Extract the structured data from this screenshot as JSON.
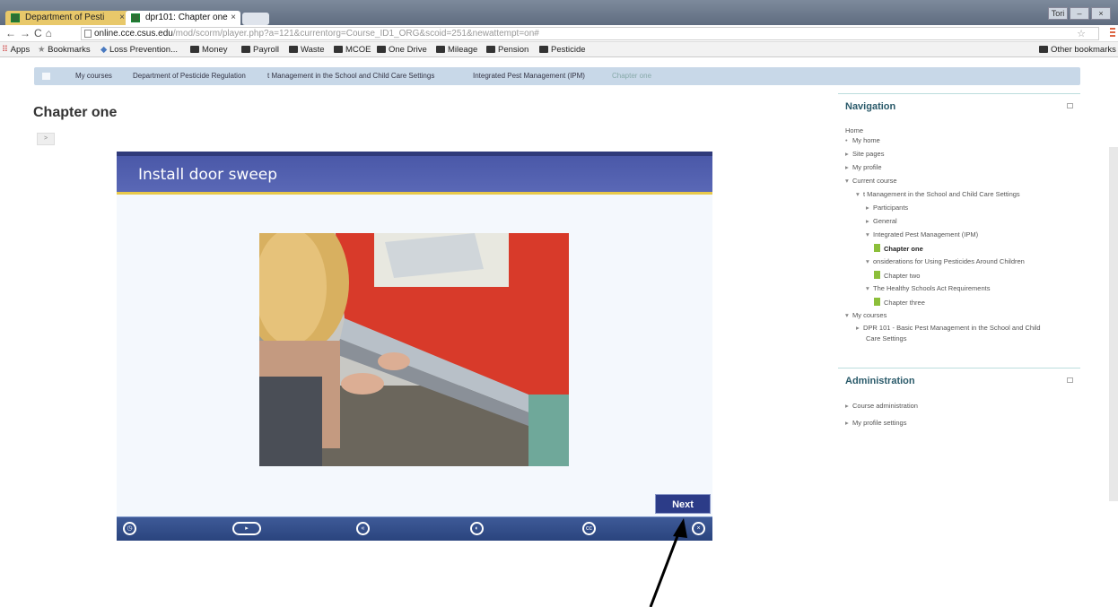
{
  "browser": {
    "tabs": [
      {
        "title": "Department of Pesti"
      },
      {
        "title": "dpr101: Chapter one"
      }
    ],
    "window_button": "Tori",
    "url": {
      "host": "online.cce.csus.edu",
      "path": "/mod/scorm/player.php?a=121&currentorg=Course_ID1_ORG&scoid=251&newattempt=on#"
    },
    "bookmarks": [
      "Apps",
      "Bookmarks",
      "Loss Prevention...",
      "Money",
      "Payroll",
      "Waste",
      "MCOE",
      "One Drive",
      "Mileage",
      "Pension",
      "Pesticide"
    ],
    "other_bookmarks": "Other bookmarks"
  },
  "breadcrumb": [
    "My courses",
    "Department of Pesticide Regulation",
    "t Management in the School and Child Care Settings",
    "Integrated Pest Management (IPM)",
    "Chapter one"
  ],
  "page_title": "Chapter one",
  "slide": {
    "title": "Install door sweep",
    "next_label": "Next",
    "photo_alt": "Person installing a door sweep on a red door"
  },
  "navigation": {
    "title": "Navigation",
    "items": [
      {
        "label": "Home"
      },
      {
        "label": "My home"
      },
      {
        "label": "Site pages"
      },
      {
        "label": "My profile"
      },
      {
        "label": "Current course"
      },
      {
        "label": "t Management in the School and Child Care Settings"
      },
      {
        "label": "Participants"
      },
      {
        "label": "General"
      },
      {
        "label": "Integrated Pest Management (IPM)"
      },
      {
        "label": "Chapter one"
      },
      {
        "label": "onsiderations for Using Pesticides Around Children"
      },
      {
        "label": "Chapter two"
      },
      {
        "label": "The Healthy Schools Act Requirements"
      },
      {
        "label": "Chapter three"
      },
      {
        "label": "My courses"
      },
      {
        "label": "DPR 101 - Basic Pest Management in the School and Child"
      },
      {
        "label": "Care Settings"
      }
    ]
  },
  "administration": {
    "title": "Administration",
    "items": [
      {
        "label": "Course administration"
      },
      {
        "label": "My profile settings"
      }
    ]
  },
  "colors": {
    "accent": "#2c3c88",
    "banner": "#4a58a8",
    "breadcrumb_bg": "#c8d8e8",
    "book_icon": "#8cbf3a"
  }
}
